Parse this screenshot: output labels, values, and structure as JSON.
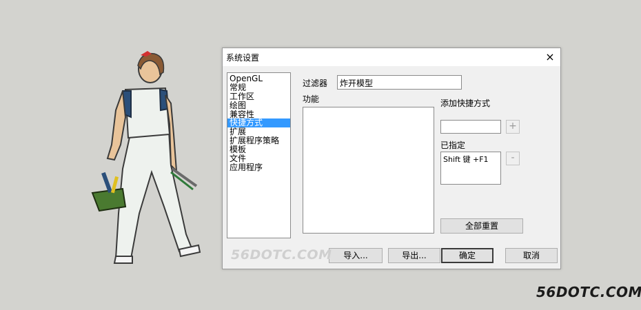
{
  "dialog": {
    "title": "系统设置",
    "close_glyph": "×"
  },
  "categories": [
    {
      "label": "OpenGL",
      "selected": false
    },
    {
      "label": "常规",
      "selected": false
    },
    {
      "label": "工作区",
      "selected": false
    },
    {
      "label": "绘图",
      "selected": false
    },
    {
      "label": "兼容性",
      "selected": false
    },
    {
      "label": "快捷方式",
      "selected": true
    },
    {
      "label": "扩展",
      "selected": false
    },
    {
      "label": "扩展程序策略",
      "selected": false
    },
    {
      "label": "模板",
      "selected": false
    },
    {
      "label": "文件",
      "selected": false
    },
    {
      "label": "应用程序",
      "selected": false
    }
  ],
  "filter": {
    "label": "过滤器",
    "value": "炸开模型"
  },
  "function_label": "功能",
  "add_shortcut": {
    "label": "添加快捷方式",
    "value": "",
    "add_glyph": "+"
  },
  "assigned": {
    "label": "已指定",
    "items": [
      "Shift 键 +F1"
    ],
    "remove_glyph": "-"
  },
  "buttons": {
    "reset_all": "全部重置",
    "import": "导入...",
    "export": "导出...",
    "ok": "确定",
    "cancel": "取消"
  },
  "watermarks": {
    "inner": "56DOTC.COM",
    "outer": "56DOTC.COM"
  },
  "colors": {
    "selection": "#3399ff",
    "background": "#d3d3cf"
  }
}
